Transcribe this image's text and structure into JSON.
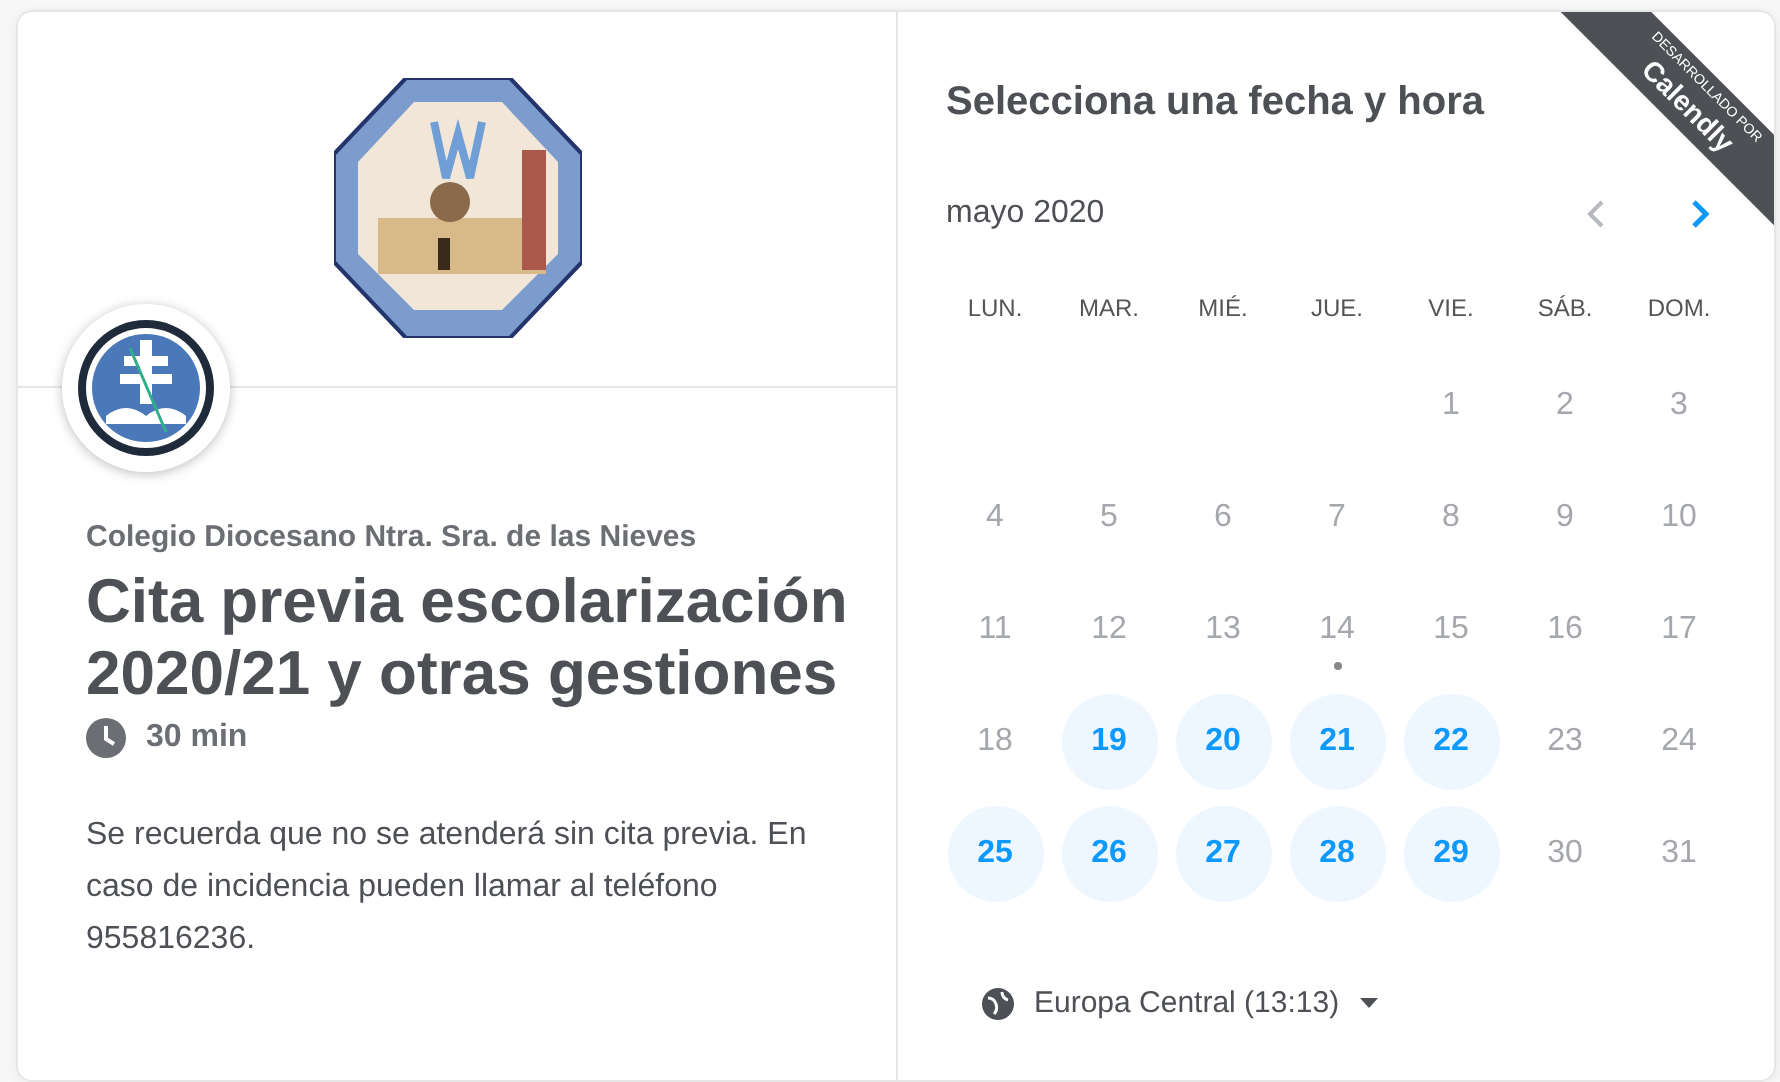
{
  "ribbon": {
    "small": "DESARROLLADO POR",
    "brand": "Calendly"
  },
  "event": {
    "organizer": "Colegio Diocesano Ntra. Sra. de las Nieves",
    "title": "Cita previa escolarización 2020/21 y otras gestiones",
    "duration": "30 min",
    "description": "Se recuerda que no se atenderá sin cita previa. En caso de incidencia pueden llamar al teléfono 955816236."
  },
  "calendar": {
    "heading": "Selecciona una fecha y hora",
    "month": "mayo 2020",
    "prev": {
      "disabled": true
    },
    "next": {
      "disabled": false
    },
    "weekdays": [
      "LUN.",
      "MAR.",
      "MIÉ.",
      "JUE.",
      "VIE.",
      "SÁB.",
      "DOM."
    ],
    "weeks": [
      [
        {
          "day": "1",
          "available": false,
          "today": false
        },
        {
          "day": "2",
          "available": false,
          "today": false
        },
        {
          "day": "3",
          "available": false,
          "today": false
        }
      ],
      [
        {
          "day": "4",
          "available": false,
          "today": false
        },
        {
          "day": "5",
          "available": false,
          "today": false
        },
        {
          "day": "6",
          "available": false,
          "today": false
        },
        {
          "day": "7",
          "available": false,
          "today": false
        },
        {
          "day": "8",
          "available": false,
          "today": false
        },
        {
          "day": "9",
          "available": false,
          "today": false
        },
        {
          "day": "10",
          "available": false,
          "today": false
        }
      ],
      [
        {
          "day": "11",
          "available": false,
          "today": false
        },
        {
          "day": "12",
          "available": false,
          "today": false
        },
        {
          "day": "13",
          "available": false,
          "today": false
        },
        {
          "day": "14",
          "available": false,
          "today": true
        },
        {
          "day": "15",
          "available": false,
          "today": false
        },
        {
          "day": "16",
          "available": false,
          "today": false
        },
        {
          "day": "17",
          "available": false,
          "today": false
        }
      ],
      [
        {
          "day": "18",
          "available": false,
          "today": false
        },
        {
          "day": "19",
          "available": true,
          "today": false
        },
        {
          "day": "20",
          "available": true,
          "today": false
        },
        {
          "day": "21",
          "available": true,
          "today": false
        },
        {
          "day": "22",
          "available": true,
          "today": false
        },
        {
          "day": "23",
          "available": false,
          "today": false
        },
        {
          "day": "24",
          "available": false,
          "today": false
        }
      ],
      [
        {
          "day": "25",
          "available": true,
          "today": false
        },
        {
          "day": "26",
          "available": true,
          "today": false
        },
        {
          "day": "27",
          "available": true,
          "today": false
        },
        {
          "day": "28",
          "available": true,
          "today": false
        },
        {
          "day": "29",
          "available": true,
          "today": false
        },
        {
          "day": "30",
          "available": false,
          "today": false
        },
        {
          "day": "31",
          "available": false,
          "today": false
        }
      ]
    ],
    "timezone": "Europa Central (13:13)"
  }
}
